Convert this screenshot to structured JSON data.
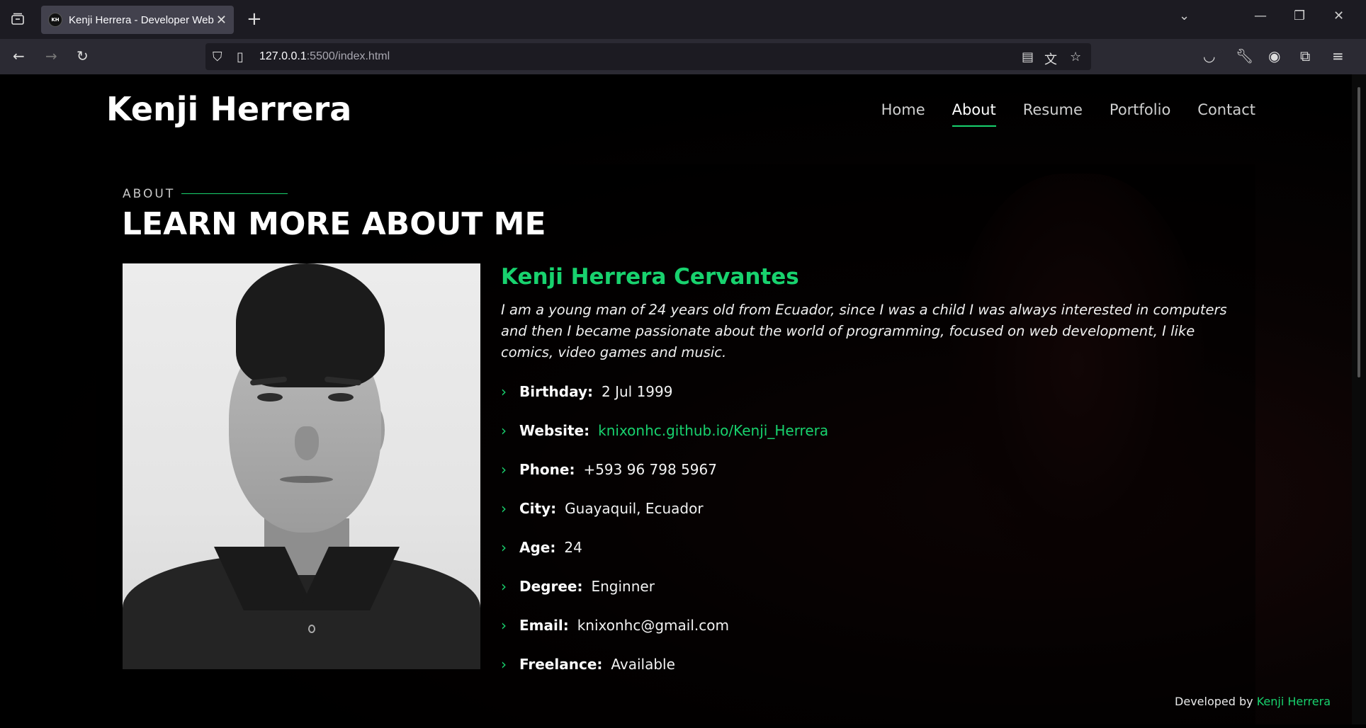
{
  "browser": {
    "tab_title": "Kenji Herrera - Developer Web",
    "favicon_text": "KH",
    "url_host": "127.0.0.1",
    "url_path": ":5500/index.html"
  },
  "site": {
    "logo": "Kenji Herrera",
    "menu": [
      {
        "label": "Home"
      },
      {
        "label": "About"
      },
      {
        "label": "Resume"
      },
      {
        "label": "Portfolio"
      },
      {
        "label": "Contact"
      }
    ]
  },
  "about": {
    "subtitle": "ABOUT",
    "title": "LEARN MORE ABOUT ME",
    "name": "Kenji Herrera Cervantes",
    "bio": "I am a young man of 24 years old from Ecuador, since I was a child I was always interested in computers and then I became passionate about the world of programming, focused on web development, I like comics, video games and music.",
    "info": [
      {
        "label": "Birthday:",
        "value": "2 Jul 1999"
      },
      {
        "label": "Website:",
        "value": "knixonhc.github.io/Kenji_Herrera"
      },
      {
        "label": "Phone:",
        "value": "+593 96 798 5967"
      },
      {
        "label": "City:",
        "value": "Guayaquil, Ecuador"
      },
      {
        "label": "Age:",
        "value": "24"
      },
      {
        "label": "Degree:",
        "value": "Enginner"
      },
      {
        "label": "Email:",
        "value": "knixonhc@gmail.com"
      },
      {
        "label": "Freelance:",
        "value": "Available"
      }
    ]
  },
  "footer": {
    "prefix": "Developed by",
    "author": "Kenji Herrera"
  },
  "colors": {
    "accent": "#18d26e",
    "background": "#000000"
  },
  "icons": [
    "tab-list-icon",
    "back-icon",
    "forward-icon",
    "reload-icon",
    "shield-icon",
    "page-icon",
    "reader-view-icon",
    "translate-icon",
    "bookmark-star-icon",
    "pocket-icon",
    "wrench-icon",
    "account-icon",
    "extensions-icon",
    "menu-icon",
    "chevron-right-icon"
  ]
}
